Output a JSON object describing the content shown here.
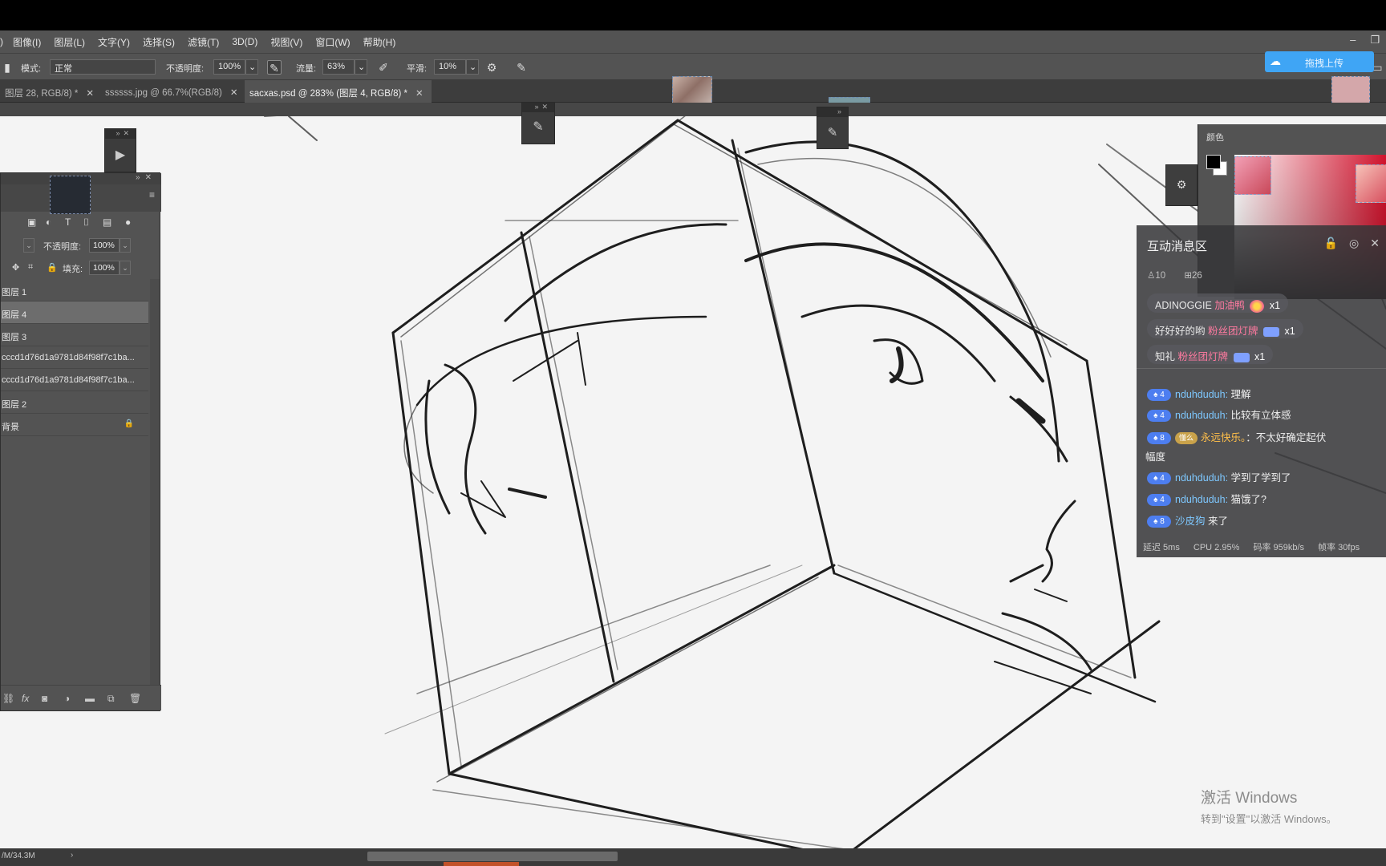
{
  "menu": [
    "图像(I)",
    "图层(L)",
    "文字(Y)",
    "选择(S)",
    "滤镜(T)",
    "3D(D)",
    "视图(V)",
    "窗口(W)",
    "帮助(H)"
  ],
  "menu_left_fragment": ")",
  "options": {
    "mode_label": "模式:",
    "mode_value": "正常",
    "opacity_label": "不透明度:",
    "opacity_value": "100%",
    "flow_label": "流量:",
    "flow_value": "63%",
    "smooth_label": "平滑:",
    "smooth_value": "10%"
  },
  "upload_button": "拖拽上传",
  "tabs": [
    {
      "label": "图层 28, RGB/8) *",
      "active": false
    },
    {
      "label": "ssssss.jpg @ 66.7%(RGB/8)",
      "active": false
    },
    {
      "label": "sacxas.psd @ 283% (图层 4, RGB/8) *",
      "active": true
    }
  ],
  "layers_panel": {
    "opacity_label": "不透明度:",
    "opacity_value": "100%",
    "fill_label": "填充:",
    "fill_value": "100%",
    "layers": [
      {
        "name": "图层 1",
        "selected": false,
        "locked": false
      },
      {
        "name": "图层 4",
        "selected": true,
        "locked": false
      },
      {
        "name": "图层 3",
        "selected": false,
        "locked": false
      },
      {
        "name": "cccd1d76d1a9781d84f98f7c1ba...",
        "selected": false,
        "locked": false
      },
      {
        "name": "cccd1d76d1a9781d84f98f7c1ba...",
        "selected": false,
        "locked": false
      },
      {
        "name": "图层 2",
        "selected": false,
        "locked": false
      },
      {
        "name": "背景",
        "selected": false,
        "locked": true
      }
    ]
  },
  "color_panel": {
    "title": "颜色",
    "foreground": "#000000",
    "background": "#ffffff",
    "hue": "#d1122c"
  },
  "chat": {
    "title": "互动消息区",
    "viewers": "10",
    "total": "26",
    "gifts": [
      {
        "user": "ADINOGGIE",
        "gift": "加油鸭",
        "count": "x1"
      },
      {
        "user": "好好好的哟",
        "gift": "粉丝团灯牌",
        "count": "x1"
      },
      {
        "user": "知礼",
        "gift": "粉丝团灯牌",
        "count": "x1"
      }
    ],
    "messages": [
      {
        "level": "4",
        "user": "nduhduduh:",
        "text": "理解"
      },
      {
        "level": "4",
        "user": "nduhduduh:",
        "text": "比较有立体感"
      },
      {
        "level": "8",
        "fan": "懂么",
        "user": "永远快乐。",
        "text": "：不太好确定起伏",
        "wrap": "幅度"
      },
      {
        "level": "4",
        "user": "nduhduduh:",
        "text": "学到了学到了"
      },
      {
        "level": "4",
        "user": "nduhduduh:",
        "text": "猫饿了?"
      },
      {
        "level": "8",
        "user": "沙皮狗",
        "text": "来了"
      }
    ],
    "stats": {
      "latency": "延迟 5ms",
      "cpu": "CPU 2.95%",
      "bitrate": "码率 959kb/s",
      "fps": "帧率 30fps"
    }
  },
  "watermark": {
    "line1": "激活 Windows",
    "line2": "转到\"设置\"以激活 Windows。"
  },
  "status": {
    "doc_size": "/M/34.3M"
  },
  "icons": [
    "play-icon",
    "brush-icon",
    "gear-icon",
    "search-icon",
    "lock-icon",
    "close-icon",
    "settings-icon",
    "cloud-icon"
  ]
}
